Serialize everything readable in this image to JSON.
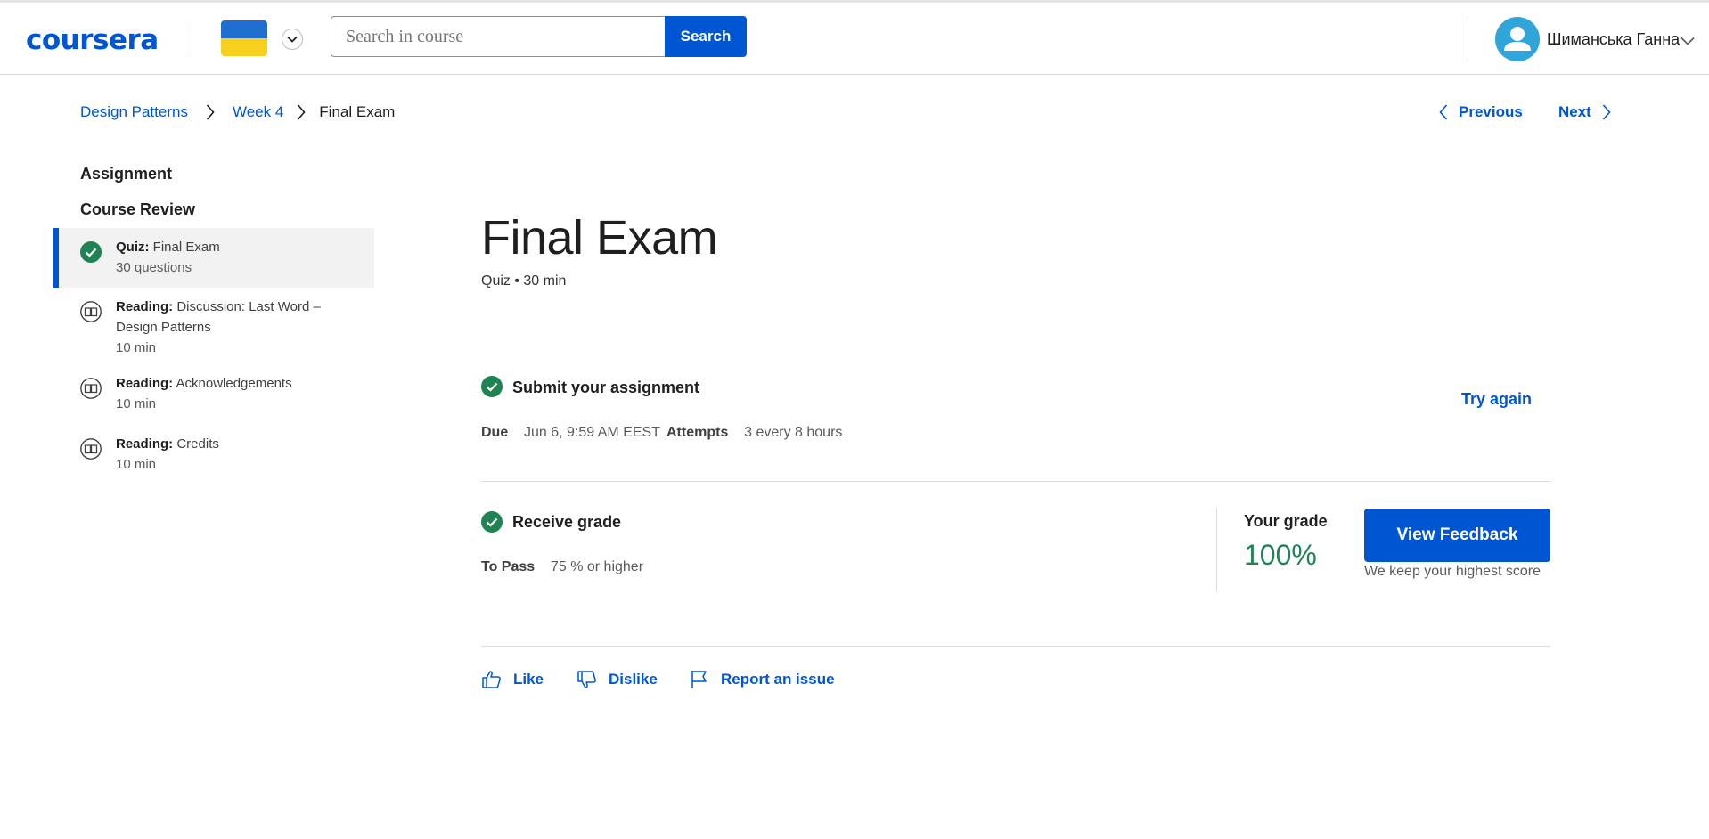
{
  "header": {
    "logo": "coursera",
    "search": {
      "placeholder": "Search in course",
      "value": "",
      "button_label": "Search"
    },
    "user": {
      "name": "Шиманська Ганна"
    },
    "colors": {
      "brand": "#0056d2",
      "flag_blue": "#1f6fd1",
      "flag_yellow": "#f7cf1d",
      "avatar": "#2fa5d9"
    }
  },
  "breadcrumb": {
    "items": [
      "Design Patterns",
      "Week 4"
    ],
    "current": "Final Exam"
  },
  "nav": {
    "previous": "Previous",
    "next": "Next"
  },
  "sidebar": {
    "section": "Assignment",
    "group": "Course Review",
    "items": [
      {
        "kind": "Quiz:",
        "title": "Final Exam",
        "meta": "30 questions",
        "icon": "completed-check-icon",
        "active": true
      },
      {
        "kind": "Reading:",
        "title": "Discussion: Last Word – Design Patterns",
        "meta": "10 min",
        "icon": "book-icon",
        "active": false
      },
      {
        "kind": "Reading:",
        "title": "Acknowledgements",
        "meta": "10 min",
        "icon": "book-icon",
        "active": false
      },
      {
        "kind": "Reading:",
        "title": "Credits",
        "meta": "10 min",
        "icon": "book-icon",
        "active": false
      }
    ]
  },
  "main": {
    "title": "Final Exam",
    "subtitle": "Quiz • 30 min",
    "submit": {
      "title": "Submit your assignment",
      "due_label": "Due",
      "due_value": "Jun 6, 9:59 AM EEST",
      "attempts_label": "Attempts",
      "attempts_value": "3 every 8 hours",
      "try_again": "Try again"
    },
    "grade": {
      "title": "Receive grade",
      "pass_label": "To Pass",
      "pass_value": "75 % or higher",
      "your_grade_label": "Your grade",
      "your_grade_value": "100%",
      "feedback_button": "View Feedback",
      "note": "We keep your highest score"
    },
    "actions": {
      "like": "Like",
      "dislike": "Dislike",
      "report": "Report an issue"
    },
    "colors": {
      "success": "#1f8354",
      "link": "#0056d2"
    }
  }
}
